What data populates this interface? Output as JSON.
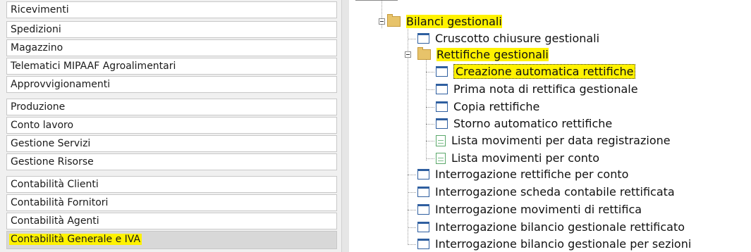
{
  "left_menu": {
    "items": [
      {
        "label": "Ricevimenti"
      },
      {
        "label": "Spedizioni"
      },
      {
        "label": "Magazzino"
      },
      {
        "label": "Telematici MIPAAF Agroalimentari"
      },
      {
        "label": "Approvvigionamenti"
      },
      {
        "label": "Produzione"
      },
      {
        "label": "Conto lavoro"
      },
      {
        "label": "Gestione Servizi"
      },
      {
        "label": "Gestione Risorse"
      },
      {
        "label": "Contabilità Clienti"
      },
      {
        "label": "Contabilità Fornitori"
      },
      {
        "label": "Contabilità Agenti"
      },
      {
        "label": "Contabilità Generale e IVA",
        "selected": true
      }
    ]
  },
  "tree": {
    "root": {
      "label": "Bilanci gestionali",
      "icon": "folder-icon",
      "expanded": true
    },
    "items": [
      {
        "label": "Cruscotto chiusure gestionali",
        "icon": "window-icon"
      },
      {
        "label": "Rettifiche gestionali",
        "icon": "folder-icon",
        "expanded": true
      },
      {
        "label": "Creazione automatica rettifiche",
        "icon": "window-icon",
        "selected": true
      },
      {
        "label": "Prima nota di rettifica gestionale",
        "icon": "window-icon"
      },
      {
        "label": "Copia rettifiche",
        "icon": "window-icon"
      },
      {
        "label": "Storno automatico rettifiche",
        "icon": "window-icon"
      },
      {
        "label": "Lista movimenti per data registrazione",
        "icon": "list-icon"
      },
      {
        "label": "Lista movimenti per conto",
        "icon": "list-icon"
      },
      {
        "label": "Interrogazione rettifiche per conto",
        "icon": "window-icon"
      },
      {
        "label": "Interrogazione scheda contabile rettificata",
        "icon": "window-icon"
      },
      {
        "label": "Interrogazione movimenti di rettifica",
        "icon": "window-icon"
      },
      {
        "label": "Interrogazione bilancio gestionale rettificato",
        "icon": "window-icon"
      },
      {
        "label": "Interrogazione bilancio gestionale per sezioni",
        "icon": "window-icon"
      }
    ]
  },
  "colors": {
    "highlight": "#fff200",
    "panel_bg": "#f0f0f0",
    "selected_bg": "#d8d8d8"
  }
}
